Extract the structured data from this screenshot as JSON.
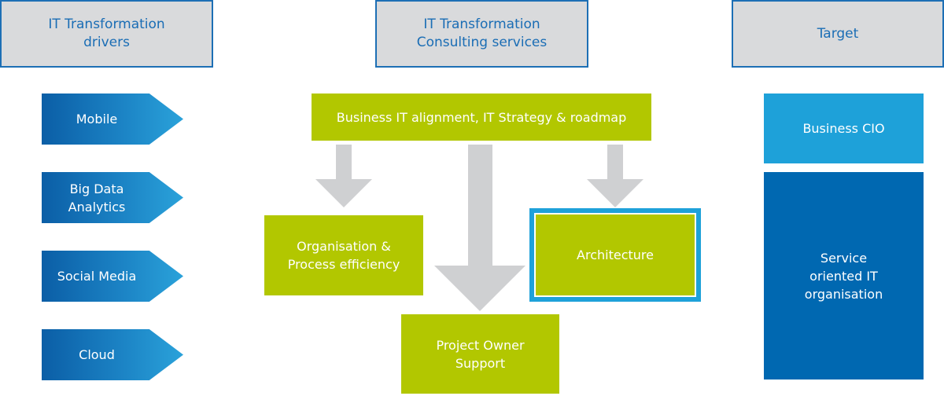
{
  "headers": {
    "drivers": "IT Transformation\ndrivers",
    "consulting": "IT Transformation\nConsulting services",
    "target": "Target"
  },
  "drivers": [
    "Mobile",
    "Big Data\nAnalytics",
    "Social Media",
    "Cloud"
  ],
  "services": {
    "strategy": "Business IT alignment, IT Strategy & roadmap",
    "organisation": "Organisation &\nProcess efficiency",
    "architecture": "Architecture",
    "project_owner": "Project Owner\nSupport"
  },
  "target": {
    "business_cio": "Business CIO",
    "service_oriented": "Service\noriented IT\norganisation"
  },
  "colors": {
    "header_bg": "#d9dadc",
    "header_border": "#1d6fb5",
    "header_text": "#1a6db5",
    "green": "#b2c700",
    "arrow_gray": "#cfd0d2",
    "light_blue": "#1ea1d9",
    "dark_blue": "#0068b1"
  }
}
